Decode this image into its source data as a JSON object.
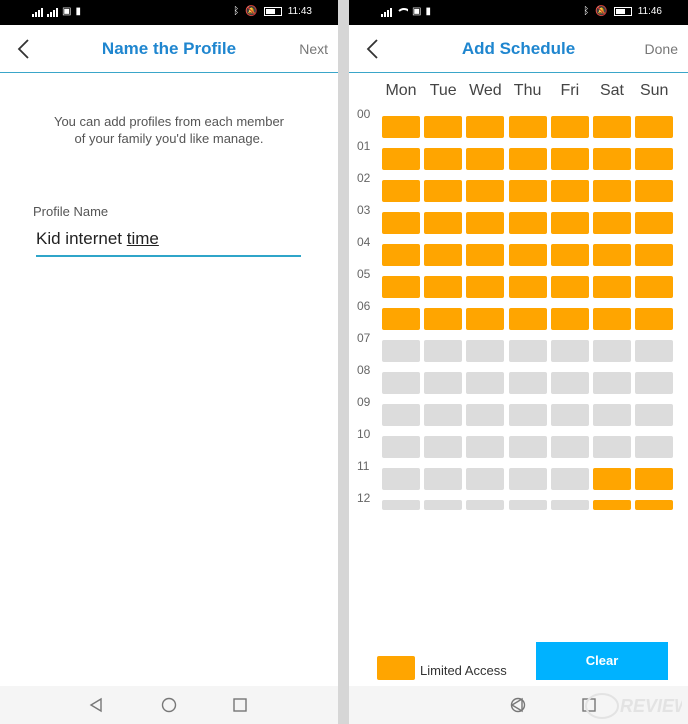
{
  "left": {
    "status": {
      "time": "11:43"
    },
    "header": {
      "title": "Name the Profile",
      "action": "Next"
    },
    "intro": "You can add profiles from each member of your family you'd like manage.",
    "field": {
      "label": "Profile Name",
      "value_main": "Kid internet ",
      "value_underlined": "time"
    }
  },
  "right": {
    "status": {
      "time": "11:46"
    },
    "header": {
      "title": "Add Schedule",
      "action": "Done"
    },
    "days": [
      "Mon",
      "Tue",
      "Wed",
      "Thu",
      "Fri",
      "Sat",
      "Sun"
    ],
    "hours": [
      "00",
      "01",
      "02",
      "03",
      "04",
      "05",
      "06",
      "07",
      "08",
      "09",
      "10",
      "11",
      "12"
    ],
    "schedule": [
      [
        1,
        1,
        1,
        1,
        1,
        1,
        1
      ],
      [
        1,
        1,
        1,
        1,
        1,
        1,
        1
      ],
      [
        1,
        1,
        1,
        1,
        1,
        1,
        1
      ],
      [
        1,
        1,
        1,
        1,
        1,
        1,
        1
      ],
      [
        1,
        1,
        1,
        1,
        1,
        1,
        1
      ],
      [
        1,
        1,
        1,
        1,
        1,
        1,
        1
      ],
      [
        1,
        1,
        1,
        1,
        1,
        1,
        1
      ],
      [
        0,
        0,
        0,
        0,
        0,
        0,
        0
      ],
      [
        0,
        0,
        0,
        0,
        0,
        0,
        0
      ],
      [
        0,
        0,
        0,
        0,
        0,
        0,
        0
      ],
      [
        0,
        0,
        0,
        0,
        0,
        0,
        0
      ],
      [
        0,
        0,
        0,
        0,
        0,
        1,
        1
      ],
      [
        0,
        0,
        0,
        0,
        0,
        1,
        1
      ]
    ],
    "legend": {
      "label": "Limited Access"
    },
    "clear_label": "Clear"
  },
  "colors": {
    "accent": "#1f86cf",
    "limited": "#ffa500",
    "open": "#dcdcdc",
    "clear": "#00b2ff",
    "underline": "#2fa5c9"
  },
  "icons": [
    "back-chevron-icon",
    "nav-back-icon",
    "nav-home-icon",
    "nav-recent-icon",
    "wifi-icon",
    "battery-icon",
    "bluetooth-icon",
    "mute-icon"
  ]
}
